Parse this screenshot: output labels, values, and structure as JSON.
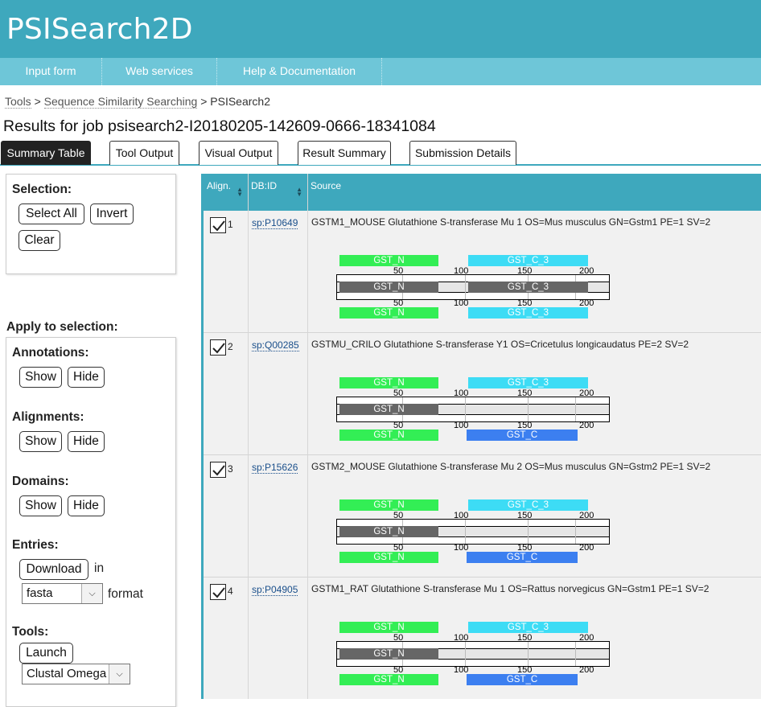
{
  "app": {
    "title": "PSISearch2D"
  },
  "nav": [
    {
      "label": "Input form"
    },
    {
      "label": "Web services"
    },
    {
      "label": "Help & Documentation"
    }
  ],
  "breadcrumb": {
    "items": [
      "Tools",
      "Sequence Similarity Searching"
    ],
    "current": "PSISearch2",
    "sep": ">"
  },
  "results_title": "Results for job psisearch2-I20180205-142609-0666-18341084",
  "tabs": [
    {
      "label": "Summary Table",
      "active": true
    },
    {
      "label": "Tool Output",
      "active": false
    },
    {
      "label": "Visual Output",
      "active": false
    },
    {
      "label": "Result Summary",
      "active": false
    },
    {
      "label": "Submission Details",
      "active": false
    }
  ],
  "sidebar": {
    "selection_heading": "Selection:",
    "select_all": "Select All",
    "invert": "Invert",
    "clear": "Clear",
    "apply_heading": "Apply to selection:",
    "annotations": "Annotations:",
    "alignments": "Alignments:",
    "domains": "Domains:",
    "show": "Show",
    "hide": "Hide",
    "entries": "Entries:",
    "download": "Download",
    "in_text": "in",
    "format_value": "fasta",
    "format_text": "format",
    "tools": "Tools:",
    "launch": "Launch",
    "tool_value": "Clustal Omega"
  },
  "table": {
    "columns": [
      {
        "label": "Align."
      },
      {
        "label": "DB:ID"
      },
      {
        "label": "Source"
      }
    ],
    "ticks": [
      "50",
      "100",
      "150",
      "200"
    ],
    "rows": [
      {
        "num": "1",
        "checked": true,
        "dbid": "sp:P10649",
        "source": "GSTM1_MOUSE Glutathione S-transferase Mu 1 OS=Mus musculus GN=Gstm1 PE=1 SV=2",
        "top": [
          "GST_N",
          "GST_C_3"
        ],
        "aln": [
          "GST_N",
          "GST_C_3"
        ],
        "bottom": [
          "GST_N",
          "GST_C_3"
        ]
      },
      {
        "num": "2",
        "checked": true,
        "dbid": "sp:Q00285",
        "source": "GSTMU_CRILO Glutathione S-transferase Y1 OS=Cricetulus longicaudatus PE=2 SV=2",
        "top": [
          "GST_N",
          "GST_C_3"
        ],
        "aln": [
          "GST_N"
        ],
        "bottom": [
          "GST_N",
          "GST_C"
        ]
      },
      {
        "num": "3",
        "checked": true,
        "dbid": "sp:P15626",
        "source": "GSTM2_MOUSE Glutathione S-transferase Mu 2 OS=Mus musculus GN=Gstm2 PE=1 SV=2",
        "top": [
          "GST_N",
          "GST_C_3"
        ],
        "aln": [
          "GST_N"
        ],
        "bottom": [
          "GST_N",
          "GST_C"
        ]
      },
      {
        "num": "4",
        "checked": true,
        "dbid": "sp:P04905",
        "source": "GSTM1_RAT Glutathione S-transferase Mu 1 OS=Rattus norvegicus GN=Gstm1 PE=1 SV=2",
        "top": [
          "GST_N",
          "GST_C_3"
        ],
        "aln": [
          "GST_N"
        ],
        "bottom": [
          "GST_N",
          "GST_C"
        ]
      }
    ]
  },
  "colors": {
    "header": "#3ea8bd",
    "nav": "#6ec6d8",
    "domain_n": "#33ee55",
    "domain_c3": "#3ddcf5",
    "domain_c": "#3c7ff0"
  }
}
